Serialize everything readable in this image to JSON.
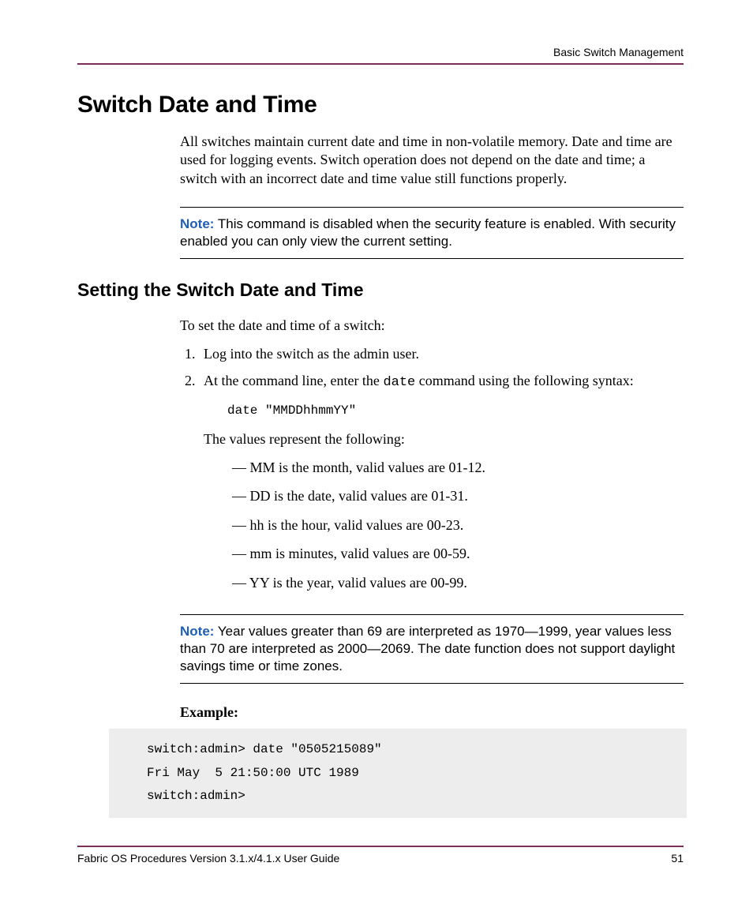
{
  "header": {
    "chapter": "Basic Switch Management"
  },
  "section": {
    "title": "Switch Date and Time",
    "intro": "All switches maintain current date and time in non-volatile memory. Date and time are used for logging events. Switch operation does not depend on the date and time; a switch with an incorrect date and time value still functions properly."
  },
  "note1": {
    "label": "Note:",
    "text": "This command is disabled when the security feature is enabled. With security enabled you can only view the current setting."
  },
  "subsection": {
    "title": "Setting the Switch Date and Time",
    "intro": "To set the date and time of a switch:",
    "step1": "Log into the switch as the admin user.",
    "step2_pre": "At the command line, enter the ",
    "step2_cmd": "date",
    "step2_post": " command using the following syntax:",
    "syntax": "date \"MMDDhhmmYY\"",
    "values_intro": "The values represent the following:",
    "values": [
      "MM is the month, valid values are 01-12.",
      "DD is the date, valid values are 01-31.",
      "hh is the hour, valid values are 00-23.",
      "mm is minutes, valid values are 00-59.",
      "YY is the year, valid values are 00-99."
    ]
  },
  "note2": {
    "label": "Note:",
    "text": "Year values greater than 69 are interpreted as 1970—1999, year values less than 70 are interpreted as 2000—2069. The date function does not support daylight savings time or time zones."
  },
  "example": {
    "label": "Example:",
    "code": "switch:admin> date \"0505215089\"\nFri May  5 21:50:00 UTC 1989\nswitch:admin>"
  },
  "footer": {
    "left": "Fabric OS Procedures Version 3.1.x/4.1.x User Guide",
    "right": "51"
  }
}
